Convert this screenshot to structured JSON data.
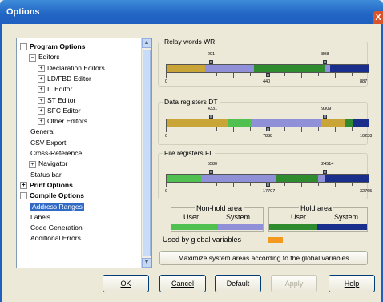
{
  "window": {
    "title": "Options",
    "close_glyph": "X"
  },
  "tree": [
    {
      "label": "Program Options",
      "level": 0,
      "expander": "−",
      "bold": true
    },
    {
      "label": "Editors",
      "level": 1,
      "expander": "−"
    },
    {
      "label": "Declaration Editors",
      "level": 2,
      "expander": "+"
    },
    {
      "label": "LD/FBD Editor",
      "level": 2,
      "expander": "+"
    },
    {
      "label": "IL Editor",
      "level": 2,
      "expander": "+"
    },
    {
      "label": "ST Editor",
      "level": 2,
      "expander": "+"
    },
    {
      "label": "SFC Editor",
      "level": 2,
      "expander": "+"
    },
    {
      "label": "Other Editors",
      "level": 2,
      "expander": "+"
    },
    {
      "label": "General",
      "level": 1,
      "expander": ""
    },
    {
      "label": "CSV Export",
      "level": 1,
      "expander": ""
    },
    {
      "label": "Cross-Reference",
      "level": 1,
      "expander": ""
    },
    {
      "label": "Navigator",
      "level": 1,
      "expander": "+"
    },
    {
      "label": "Status bar",
      "level": 1,
      "expander": ""
    },
    {
      "label": "Print Options",
      "level": 0,
      "expander": "+",
      "bold": true
    },
    {
      "label": "Compile Options",
      "level": 0,
      "expander": "−",
      "bold": true
    },
    {
      "label": "Address Ranges",
      "level": 1,
      "expander": "",
      "selected": true
    },
    {
      "label": "Labels",
      "level": 1,
      "expander": ""
    },
    {
      "label": "Code Generation",
      "level": 1,
      "expander": ""
    },
    {
      "label": "Additional Errors",
      "level": 1,
      "expander": ""
    }
  ],
  "groups": {
    "relay": {
      "label": "Relay words WR",
      "min": "0",
      "max": "887",
      "top_marks": [
        "201",
        "808"
      ],
      "bottom_mark": "440",
      "segments": [
        {
          "color": "#c8a536",
          "frac": 0.22
        },
        {
          "color": "#9090d8",
          "frac": 0.28
        },
        {
          "color": "#2e8b2e",
          "frac": 0.41
        },
        {
          "color": "#9090d8",
          "frac": 0.03
        },
        {
          "color": "#1a2e8c",
          "frac": 0.22
        }
      ]
    },
    "dt": {
      "label": "Data registers DT",
      "min": "0",
      "max": "10238",
      "top_marks": [
        "4331",
        "9309"
      ],
      "bottom_mark": "7838",
      "segments": [
        {
          "color": "#c8a536",
          "frac": 0.3
        },
        {
          "color": "#50c050",
          "frac": 0.12
        },
        {
          "color": "#9090d8",
          "frac": 0.34
        },
        {
          "color": "#c8a536",
          "frac": 0.12
        },
        {
          "color": "#2e8b2e",
          "frac": 0.04
        },
        {
          "color": "#1a2e8c",
          "frac": 0.08
        }
      ]
    },
    "fl": {
      "label": "File registers FL",
      "min": "0",
      "max": "32765",
      "top_marks": [
        "5580",
        "24514"
      ],
      "bottom_mark": "17707",
      "segments": [
        {
          "color": "#50c050",
          "frac": 0.17
        },
        {
          "color": "#9090d8",
          "frac": 0.37
        },
        {
          "color": "#2e8b2e",
          "frac": 0.21
        },
        {
          "color": "#9090d8",
          "frac": 0.03
        },
        {
          "color": "#1a2e8c",
          "frac": 0.22
        }
      ]
    }
  },
  "legend": {
    "non_hold": "Non-hold area",
    "hold": "Hold area",
    "user": "User",
    "system": "System",
    "used_by_global": "Used by global variables",
    "colors": {
      "nonhold_user": "#50c050",
      "nonhold_system": "#9090d8",
      "hold_user": "#2e8b2e",
      "hold_system": "#1a2e8c",
      "global": "#f39a1e"
    }
  },
  "maximize_button": "Maximize system areas according to the global variables",
  "buttons": {
    "ok": "OK",
    "cancel": "Cancel",
    "default": "Default",
    "apply": "Apply",
    "help": "Help"
  }
}
